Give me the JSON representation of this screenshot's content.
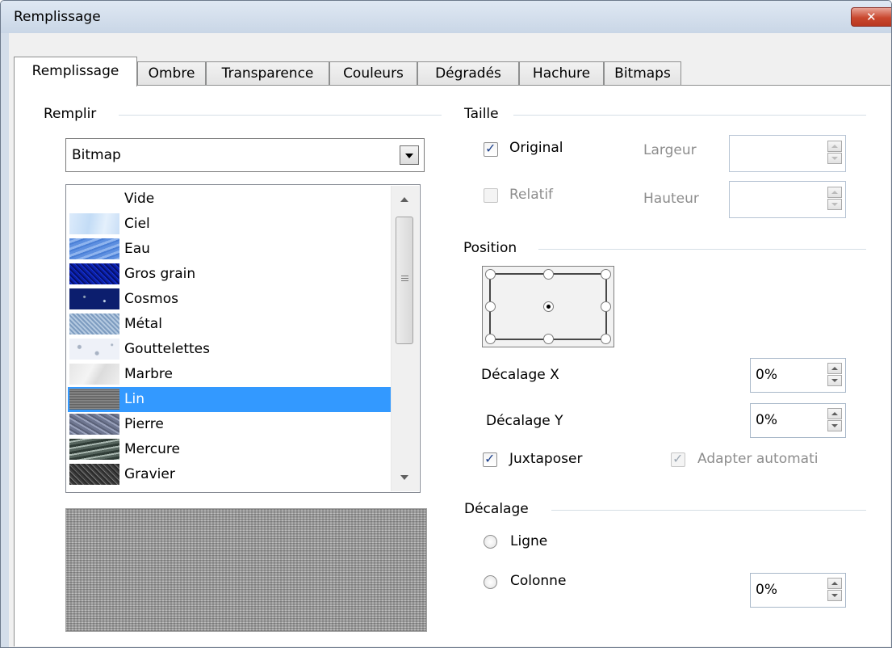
{
  "window": {
    "title": "Remplissage"
  },
  "tabs": [
    "Remplissage",
    "Ombre",
    "Transparence",
    "Couleurs",
    "Dégradés",
    "Hachure",
    "Bitmaps"
  ],
  "remplir": {
    "group_label": "Remplir",
    "fill_type": "Bitmap",
    "items": [
      "Vide",
      "Ciel",
      "Eau",
      "Gros grain",
      "Cosmos",
      "Métal",
      "Gouttelettes",
      "Marbre",
      "Lin",
      "Pierre",
      "Mercure",
      "Gravier"
    ],
    "selected": "Lin"
  },
  "taille": {
    "group_label": "Taille",
    "original_label": "Original",
    "original_checked": true,
    "relatif_label": "Relatif",
    "relatif_checked": false,
    "largeur_label": "Largeur",
    "largeur_value": "",
    "hauteur_label": "Hauteur",
    "hauteur_value": ""
  },
  "position": {
    "group_label": "Position",
    "selected_point": "center",
    "decalage_x_label": "Décalage X",
    "decalage_x_value": "0%",
    "decalage_y_label": "Décalage Y",
    "decalage_y_value": "0%",
    "juxtaposer_label": "Juxtaposer",
    "juxtaposer_checked": true,
    "adapter_label": "Adapter automati",
    "adapter_checked": true
  },
  "decalage": {
    "group_label": "Décalage",
    "ligne_label": "Ligne",
    "colonne_label": "Colonne",
    "value": "0%"
  },
  "colors": {
    "selection": "#3399ff",
    "titlebar": "#d4deea",
    "close": "#c9472e"
  }
}
